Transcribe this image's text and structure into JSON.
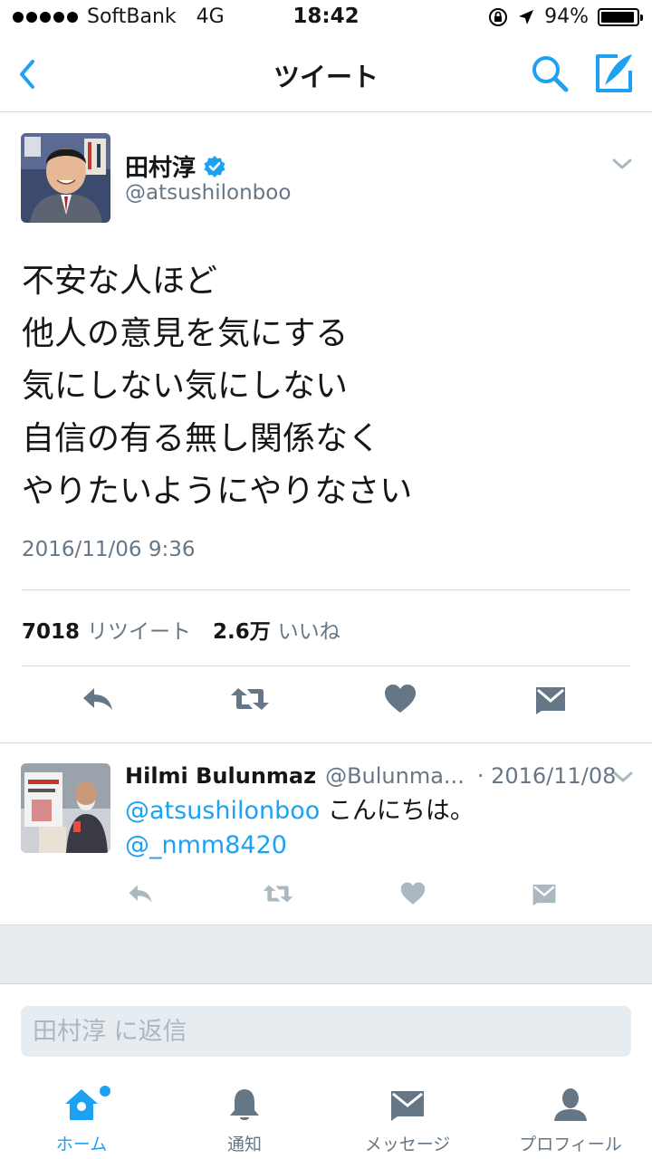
{
  "status_bar": {
    "carrier": "SoftBank",
    "network": "4G",
    "time": "18:42",
    "battery": "94%",
    "battery_level": 0.94
  },
  "nav": {
    "title": "ツイート",
    "back_icon": "chevron-left-icon",
    "search_icon": "search-icon",
    "compose_icon": "compose-icon",
    "accent_color": "#1da1f2"
  },
  "tweet": {
    "author_name": "田村淳",
    "author_handle": "@atsushilonboo",
    "verified": true,
    "text_lines": [
      "不安な人ほど",
      "他人の意見を気にする",
      "気にしない気にしない",
      "自信の有る無し関係なく",
      "やりたいようにやりなさい"
    ],
    "timestamp": "2016/11/06 9:36",
    "retweet_count": "7018",
    "retweet_label": "リツイート",
    "like_count": "2.6万",
    "like_label": "いいね"
  },
  "reply": {
    "author_name": "Hilmi Bulunmaz",
    "author_handle": "@Bulunma...",
    "timestamp": "· 2016/11/08",
    "mention_1": "@atsushilonboo",
    "text": " こんにちは。",
    "mention_2": "@_nmm8420"
  },
  "composer": {
    "placeholder": "田村淳 に返信"
  },
  "tab_bar": {
    "tabs": [
      {
        "label": "ホーム",
        "icon": "home-icon",
        "active": true
      },
      {
        "label": "通知",
        "icon": "bell-icon",
        "active": false
      },
      {
        "label": "メッセージ",
        "icon": "envelope-icon",
        "active": false
      },
      {
        "label": "プロフィール",
        "icon": "person-icon",
        "active": false
      }
    ]
  }
}
